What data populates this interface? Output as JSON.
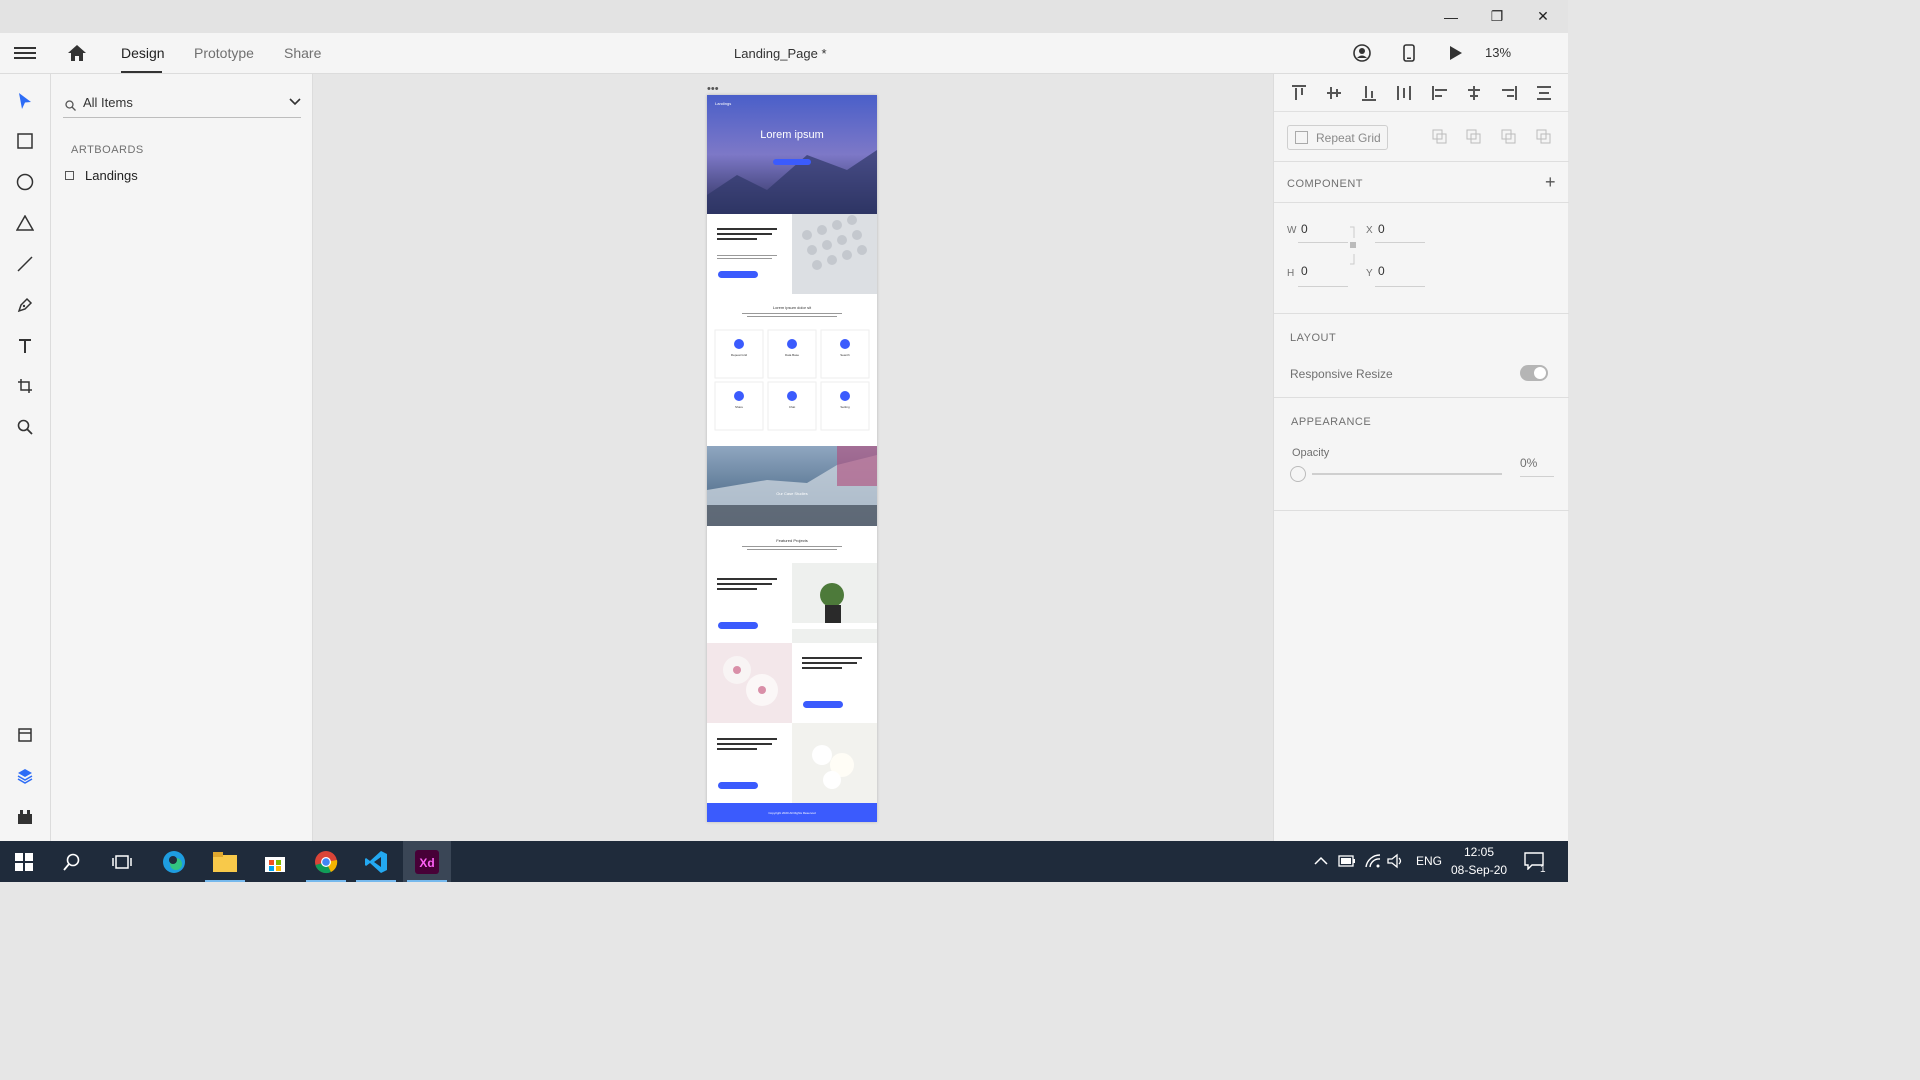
{
  "titlebar": {
    "minimize": "—",
    "restore": "❐",
    "close": "✕"
  },
  "appbar": {
    "tabs": [
      {
        "label": "Design"
      },
      {
        "label": "Prototype"
      },
      {
        "label": "Share"
      }
    ],
    "document_title": "Landing_Page *",
    "zoom": "13%"
  },
  "layers": {
    "search_value": "All Items",
    "section": "ARTBOARDS",
    "artboards": [
      "Landings"
    ]
  },
  "properties": {
    "repeat_grid": "Repeat Grid",
    "component_label": "COMPONENT",
    "width": {
      "letter": "W",
      "value": "0"
    },
    "height": {
      "letter": "H",
      "value": "0"
    },
    "x": {
      "letter": "X",
      "value": "0"
    },
    "y": {
      "letter": "Y",
      "value": "0"
    },
    "layout_label": "LAYOUT",
    "responsive_resize": "Responsive Resize",
    "appearance_label": "APPEARANCE",
    "opacity_label": "Opacity",
    "opacity_value": "0%"
  },
  "artboard": {
    "brand": "Landings",
    "hero_title": "Lorem ipsum",
    "block_title": "Lorem ipsum dolor sit amet, consectetur adipiscing elit.",
    "features_title": "Lorem ipsum dolor sit",
    "feature_labels": [
      "Repeat Grid",
      "Data Base",
      "Search",
      "Share",
      "Chat",
      "Setting"
    ],
    "case_studies": "Our Case Studies",
    "featured_projects": "Featured Projects",
    "footer": "Copyright 2020 All Rights Reserved"
  },
  "taskbar": {
    "language": "ENG",
    "time": "12:05",
    "date": "08-Sep-20",
    "notifications": "1"
  },
  "colors": {
    "accent": "#3b5bfd",
    "xd_purple": "#470137",
    "xd_pink": "#ff61f6"
  }
}
